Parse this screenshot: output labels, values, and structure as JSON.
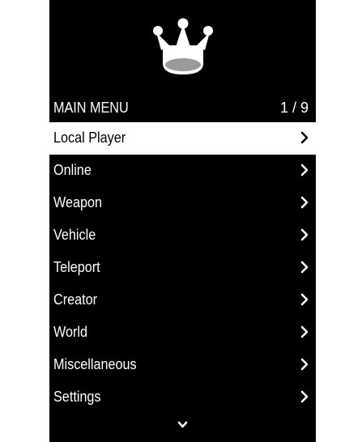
{
  "menu": {
    "title": "MAIN MENU",
    "page_counter": "1 / 9",
    "logo_icon": "crown-icon",
    "items": [
      {
        "label": "Local Player",
        "selected": true
      },
      {
        "label": "Online",
        "selected": false
      },
      {
        "label": "Weapon",
        "selected": false
      },
      {
        "label": "Vehicle",
        "selected": false
      },
      {
        "label": "Teleport",
        "selected": false
      },
      {
        "label": "Creator",
        "selected": false
      },
      {
        "label": "World",
        "selected": false
      },
      {
        "label": "Miscellaneous",
        "selected": false
      },
      {
        "label": "Settings",
        "selected": false
      }
    ],
    "item_icon": "chevron-right-icon",
    "footer_icon": "chevron-down-icon"
  },
  "colors": {
    "background": "#000000",
    "text": "#ffffff",
    "selected_background": "#ffffff",
    "selected_text": "#000000",
    "logo_fill": "#ffffff",
    "logo_accent": "#9a9a9a"
  }
}
